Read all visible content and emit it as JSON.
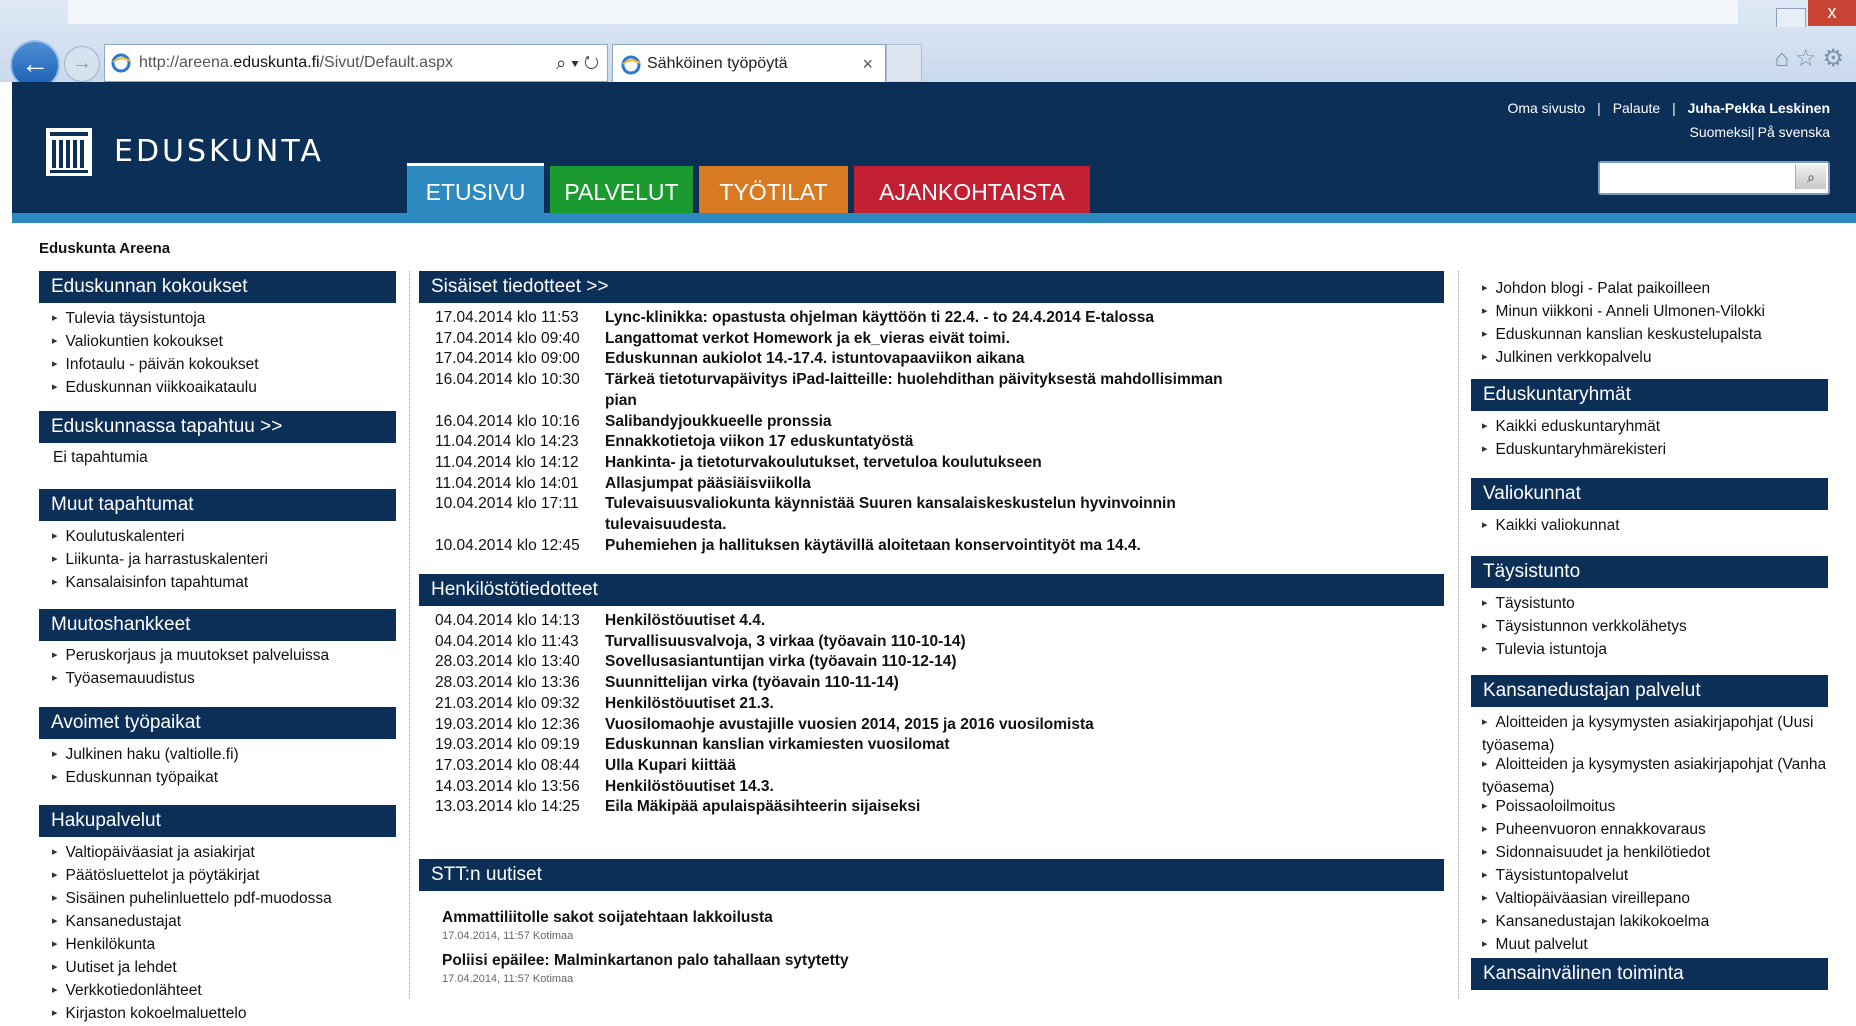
{
  "browser": {
    "url_prefix": "http://areena.",
    "url_host": "eduskunta.fi",
    "url_path": "/Sivut/Default.aspx",
    "address_tools": "⌕ ▾ ↻",
    "tab_title": "Sähköinen työpöytä",
    "tab_close": "×",
    "back_glyph": "←",
    "forward_glyph": "→",
    "close_glyph": "x",
    "toolbar_icons": "⌂☆⚙"
  },
  "header": {
    "logo_text": "EDUSKUNTA",
    "oma_sivusto": "Oma sivusto",
    "palaute": "Palaute",
    "separator": "|",
    "user": "Juha-Pekka Leskinen",
    "lang_fi": "Suomeksi",
    "lang_sv": "På svenska",
    "search_icon": "⌕",
    "tabs": [
      "ETUSIVU",
      "PALVELUT",
      "TYÖTILAT",
      "AJANKOHTAISTA"
    ]
  },
  "breadcrumb": "Eduskunta Areena",
  "left": {
    "kokoukset": {
      "title": "Eduskunnan kokoukset",
      "items": [
        "Tulevia täysistuntoja",
        "Valiokuntien kokoukset",
        "Infotaulu - päivän kokoukset",
        "Eduskunnan viikkoaikataulu"
      ]
    },
    "tapahtuu": {
      "title": "Eduskunnassa tapahtuu >>",
      "text": "Ei tapahtumia"
    },
    "muut": {
      "title": "Muut tapahtumat",
      "items": [
        "Koulutuskalenteri",
        "Liikunta- ja harrastuskalenteri",
        "Kansalaisinfon tapahtumat"
      ]
    },
    "muutoshankkeet": {
      "title": "Muutoshankkeet",
      "items": [
        "Peruskorjaus ja muutokset palveluissa",
        "Työasemauudistus"
      ]
    },
    "avoimet": {
      "title": "Avoimet työpaikat",
      "items": [
        "Julkinen haku (valtiolle.fi)",
        "Eduskunnan työpaikat"
      ]
    },
    "hakupalvelut": {
      "title": "Hakupalvelut",
      "items": [
        "Valtiopäiväasiat ja asiakirjat",
        "Päätösluettelot ja pöytäkirjat",
        "Sisäinen puhelinluettelo pdf-muodossa",
        "Kansanedustajat",
        "Henkilökunta",
        "Uutiset ja lehdet",
        "Verkkotiedonlähteet",
        "Kirjaston kokoelmaluettelo"
      ]
    }
  },
  "center": {
    "sisaiset": {
      "title": "Sisäiset tiedotteet >>",
      "rows": [
        {
          "date": "17.04.2014 klo 11:53",
          "text": "Lync-klinikka: opastusta ohjelman käyttöön ti 22.4. - to 24.4.2014 E-talossa"
        },
        {
          "date": "17.04.2014 klo 09:40",
          "text": "Langattomat verkot Homework ja ek_vieras eivät toimi."
        },
        {
          "date": "17.04.2014 klo 09:00",
          "text": "Eduskunnan aukiolot 14.-17.4. istuntovapaaviikon aikana"
        },
        {
          "date": "16.04.2014 klo 10:30",
          "text": "Tärkeä tietoturvapäivitys iPad-laitteille: huolehdithan päivityksestä mahdollisimman pian"
        },
        {
          "date": "16.04.2014 klo 10:16",
          "text": "Salibandyjoukkueelle pronssia"
        },
        {
          "date": "11.04.2014 klo 14:23",
          "text": "Ennakkotietoja viikon 17 eduskuntatyöstä"
        },
        {
          "date": "11.04.2014 klo 14:12",
          "text": "Hankinta- ja tietoturvakoulutukset, tervetuloa koulutukseen"
        },
        {
          "date": "11.04.2014 klo 14:01",
          "text": "Allasjumpat pääsiäisviikolla"
        },
        {
          "date": "10.04.2014 klo 17:11",
          "text": "Tulevaisuusvaliokunta käynnistää Suuren kansalaiskeskustelun hyvinvoinnin tulevaisuudesta."
        },
        {
          "date": "10.04.2014 klo 12:45",
          "text": "Puhemiehen ja hallituksen käytävillä aloitetaan konservointityöt ma 14.4."
        }
      ]
    },
    "henkilosto": {
      "title": "Henkilöstötiedotteet",
      "rows": [
        {
          "date": "04.04.2014 klo 14:13",
          "text": "Henkilöstöuutiset 4.4."
        },
        {
          "date": "04.04.2014 klo 11:43",
          "text": "Turvallisuusvalvoja, 3 virkaa (työavain 110-10-14)"
        },
        {
          "date": "28.03.2014 klo 13:40",
          "text": "Sovellusasiantuntijan virka (työavain 110-12-14)"
        },
        {
          "date": "28.03.2014 klo 13:36",
          "text": "Suunnittelijan virka (työavain 110-11-14)"
        },
        {
          "date": "21.03.2014 klo 09:32",
          "text": "Henkilöstöuutiset 21.3."
        },
        {
          "date": "19.03.2014 klo 12:36",
          "text": "Vuosilomaohje avustajille vuosien 2014, 2015 ja 2016 vuosilomista"
        },
        {
          "date": "19.03.2014 klo 09:19",
          "text": "Eduskunnan kanslian virkamiesten vuosilomat"
        },
        {
          "date": "17.03.2014 klo 08:44",
          "text": "Ulla Kupari kiittää"
        },
        {
          "date": "14.03.2014 klo 13:56",
          "text": "Henkilöstöuutiset 14.3."
        },
        {
          "date": "13.03.2014 klo 14:25",
          "text": "Eila Mäkipää apulaispääsihteerin sijaiseksi"
        }
      ]
    },
    "stt": {
      "title": "STT:n uutiset",
      "items": [
        {
          "title": "Ammattiliitolle sakot soijatehtaan lakkoilusta",
          "meta": "17.04.2014, 11:57 Kotimaa"
        },
        {
          "title": "Poliisi epäilee: Malminkartanon palo tahallaan sytytetty",
          "meta": "17.04.2014, 11:57 Kotimaa"
        }
      ]
    }
  },
  "right": {
    "top_links": [
      "Johdon blogi - Palat paikoilleen",
      "Minun viikkoni - Anneli Ulmonen-Vilokki",
      "Eduskunnan kanslian keskustelupalsta",
      "Julkinen verkkopalvelu"
    ],
    "ryhmat": {
      "title": "Eduskuntaryhmät",
      "items": [
        "Kaikki eduskuntaryhmät",
        "Eduskuntaryhmärekisteri"
      ]
    },
    "valiokunnat": {
      "title": "Valiokunnat",
      "items": [
        "Kaikki valiokunnat"
      ]
    },
    "taysistunto": {
      "title": "Täysistunto",
      "items": [
        "Täysistunto",
        "Täysistunnon verkkolähetys",
        "Tulevia istuntoja"
      ]
    },
    "palvelut": {
      "title": "Kansanedustajan palvelut",
      "items": [
        "Aloitteiden ja kysymysten asiakirjapohjat (Uusi työasema)",
        "Aloitteiden ja kysymysten asiakirjapohjat (Vanha työasema)",
        "Poissaoloilmoitus",
        "Puheenvuoron ennakkovaraus",
        "Sidonnaisuudet ja henkilötiedot",
        "Täysistuntopalvelut",
        "Valtiopäiväasian vireillepano",
        "Kansanedustajan lakikokoelma",
        "Muut palvelut"
      ]
    },
    "kansainvalinen": {
      "title": "Kansainvälinen toiminta"
    }
  }
}
